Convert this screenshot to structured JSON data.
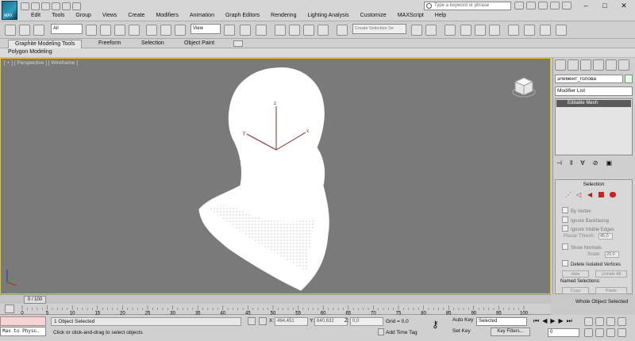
{
  "app": {
    "logo_text": "MAX"
  },
  "menu": [
    "Edit",
    "Tools",
    "Group",
    "Views",
    "Create",
    "Modifiers",
    "Animation",
    "Graph Editors",
    "Rendering",
    "Lighting Analysis",
    "Customize",
    "MAXScript",
    "Help"
  ],
  "search": {
    "placeholder": "Type a keyword or phrase"
  },
  "toolbar": {
    "selection_filter": "All",
    "ref_coord": "View",
    "named_selection": "Create Selection Se"
  },
  "ribbon": {
    "tabs": [
      "Graphite Modeling Tools",
      "Freeform",
      "Selection",
      "Object Paint"
    ],
    "sub": "Polygon Modeling"
  },
  "viewport": {
    "label": "[ + ] [ Perspective ] [ Wireframe ]",
    "axis_x": "x",
    "axis_y": "y",
    "axis_z": "z",
    "wire_color": "#ffffff",
    "bg_color": "#7a7a7a",
    "border_color": "#e8c030"
  },
  "command_panel": {
    "object_name": "элемент_голова",
    "modifier_list": "Modifier List",
    "stack_item": "Editable Mesh",
    "selection_title": "Selection",
    "by_vertex": "By Vertex",
    "ignore_backfacing": "Ignore Backfacing",
    "ignore_visible_edges": "Ignore Visible Edges",
    "planar_thresh_label": "Planar Thresh:",
    "planar_thresh_value": "45,0",
    "show_normals": "Show Normals",
    "scale_label": "Scale:",
    "scale_value": "20,0",
    "delete_isolated": "Delete Isolated Vertices",
    "hide": "Hide",
    "unhide_all": "Unhide All",
    "named_selections": "Named Selections:",
    "copy": "Copy",
    "paste": "Paste",
    "whole_object": "Whole Object Selected"
  },
  "timeline": {
    "slider": "0 / 100",
    "ticks": [
      "0",
      "5",
      "10",
      "15",
      "20",
      "25",
      "30",
      "35",
      "40",
      "45",
      "50",
      "55",
      "60",
      "65",
      "70",
      "75",
      "80",
      "85",
      "90",
      "95",
      "100"
    ]
  },
  "status": {
    "maxscript": "Max to Physc.",
    "selected": "1 Object Selected",
    "hint": "Click or click-and-drag to select objects",
    "x_label": "X:",
    "x_value": "464,451",
    "y_label": "Y:",
    "y_value": "840,632",
    "z_label": "Z:",
    "z_value": "0,0",
    "grid": "Grid = 0,0",
    "add_time_tag": "Add Time Tag",
    "auto_key": "Auto Key",
    "set_key": "Set Key",
    "key_mode": "Selected",
    "key_filters": "Key Filters...",
    "frame": "0"
  }
}
